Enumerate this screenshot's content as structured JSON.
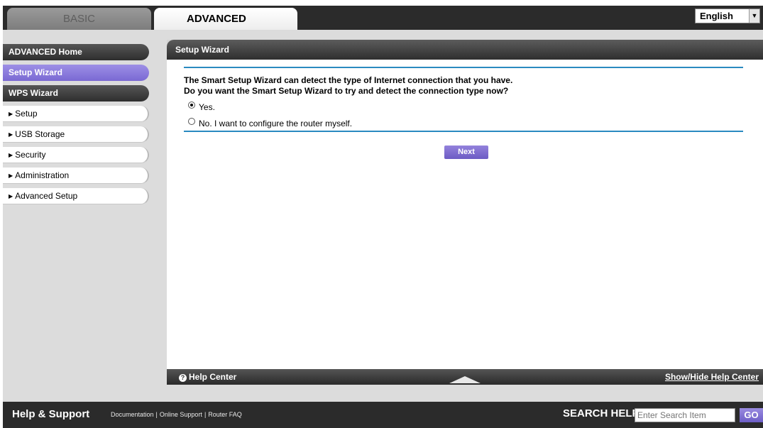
{
  "tabs": {
    "basic": "BASIC",
    "advanced": "ADVANCED"
  },
  "language": {
    "selected": "English",
    "arrow": "▼"
  },
  "sidebar": {
    "items": [
      {
        "label": "ADVANCED Home"
      },
      {
        "label": "Setup Wizard"
      },
      {
        "label": "WPS Wizard"
      },
      {
        "label": "Setup"
      },
      {
        "label": "USB Storage"
      },
      {
        "label": "Security"
      },
      {
        "label": "Administration"
      },
      {
        "label": "Advanced Setup"
      }
    ],
    "expand_marker": "▶"
  },
  "main": {
    "header": "Setup Wizard",
    "intro_line1": "The Smart Setup Wizard can detect the type of Internet connection that you have.",
    "intro_line2": "Do you want the Smart Setup Wizard to try and detect the connection type now?",
    "option_yes": "Yes.",
    "option_no": "No. I want to configure the router myself.",
    "selected_option": "yes",
    "next_label": "Next"
  },
  "help": {
    "title": "Help Center",
    "toggle": "Show/Hide Help Center",
    "icon": "?"
  },
  "footer": {
    "title": "Help & Support",
    "links": [
      "Documentation",
      "Online Support",
      "Router FAQ"
    ],
    "separator": "|",
    "search_label": "SEARCH HELP",
    "search_placeholder": "Enter Search Item",
    "go_label": "GO"
  },
  "colors": {
    "accent_purple": "#7a69d3",
    "dark_bar": "#2b2b2b",
    "rule_blue": "#2a8ac0"
  }
}
